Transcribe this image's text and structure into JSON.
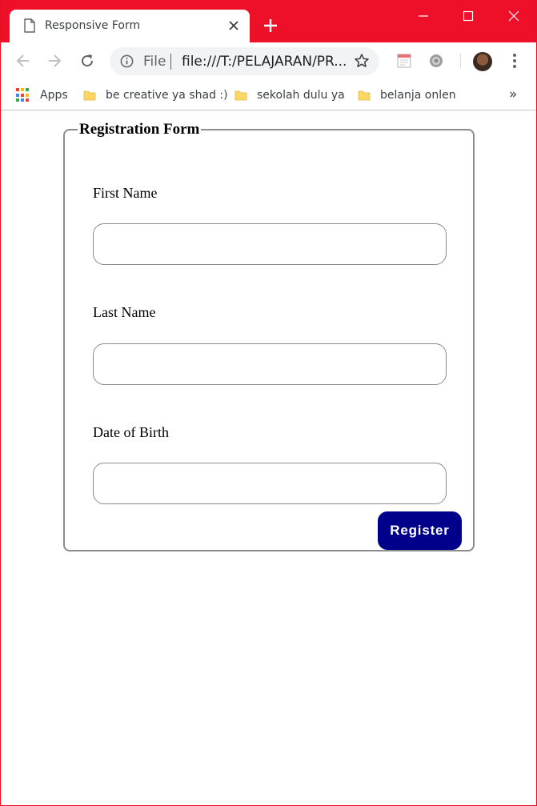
{
  "browser": {
    "tab": {
      "title": "Responsive Form",
      "page_icon": "page-icon",
      "close_icon": "close-icon"
    },
    "new_tab_icon": "plus-icon",
    "window_controls": [
      "minimize-icon",
      "maximize-icon",
      "close-icon"
    ],
    "accent_color": "#ed1028",
    "toolbar": {
      "back_icon": "arrow-left-icon",
      "forward_icon": "arrow-right-icon",
      "reload_icon": "reload-icon",
      "omnibox": {
        "scheme_label": "File",
        "url": "file:///T:/PELAJARAN/PR..."
      },
      "bookmark_star_icon": "star-icon",
      "extensions": [
        "calendar-extension-icon",
        "gear-extension-icon"
      ],
      "avatar_icon": "profile-avatar",
      "menu_icon": "kebab-menu-icon"
    },
    "bookmarks": {
      "items": [
        {
          "label": "Apps",
          "icon": "apps-grid-icon"
        },
        {
          "label": "be creative ya shad :)",
          "icon": "folder-icon"
        },
        {
          "label": "sekolah dulu ya",
          "icon": "folder-icon"
        },
        {
          "label": "belanja onlen",
          "icon": "folder-icon"
        }
      ],
      "overflow_label": "»"
    }
  },
  "form": {
    "legend": "Registration Form",
    "fields": [
      {
        "label": "First Name",
        "value": "",
        "placeholder": ""
      },
      {
        "label": "Last Name",
        "value": "",
        "placeholder": ""
      },
      {
        "label": "Date of Birth",
        "value": "",
        "placeholder": ""
      }
    ],
    "submit_label": "Register",
    "submit_color": "#00008b"
  }
}
